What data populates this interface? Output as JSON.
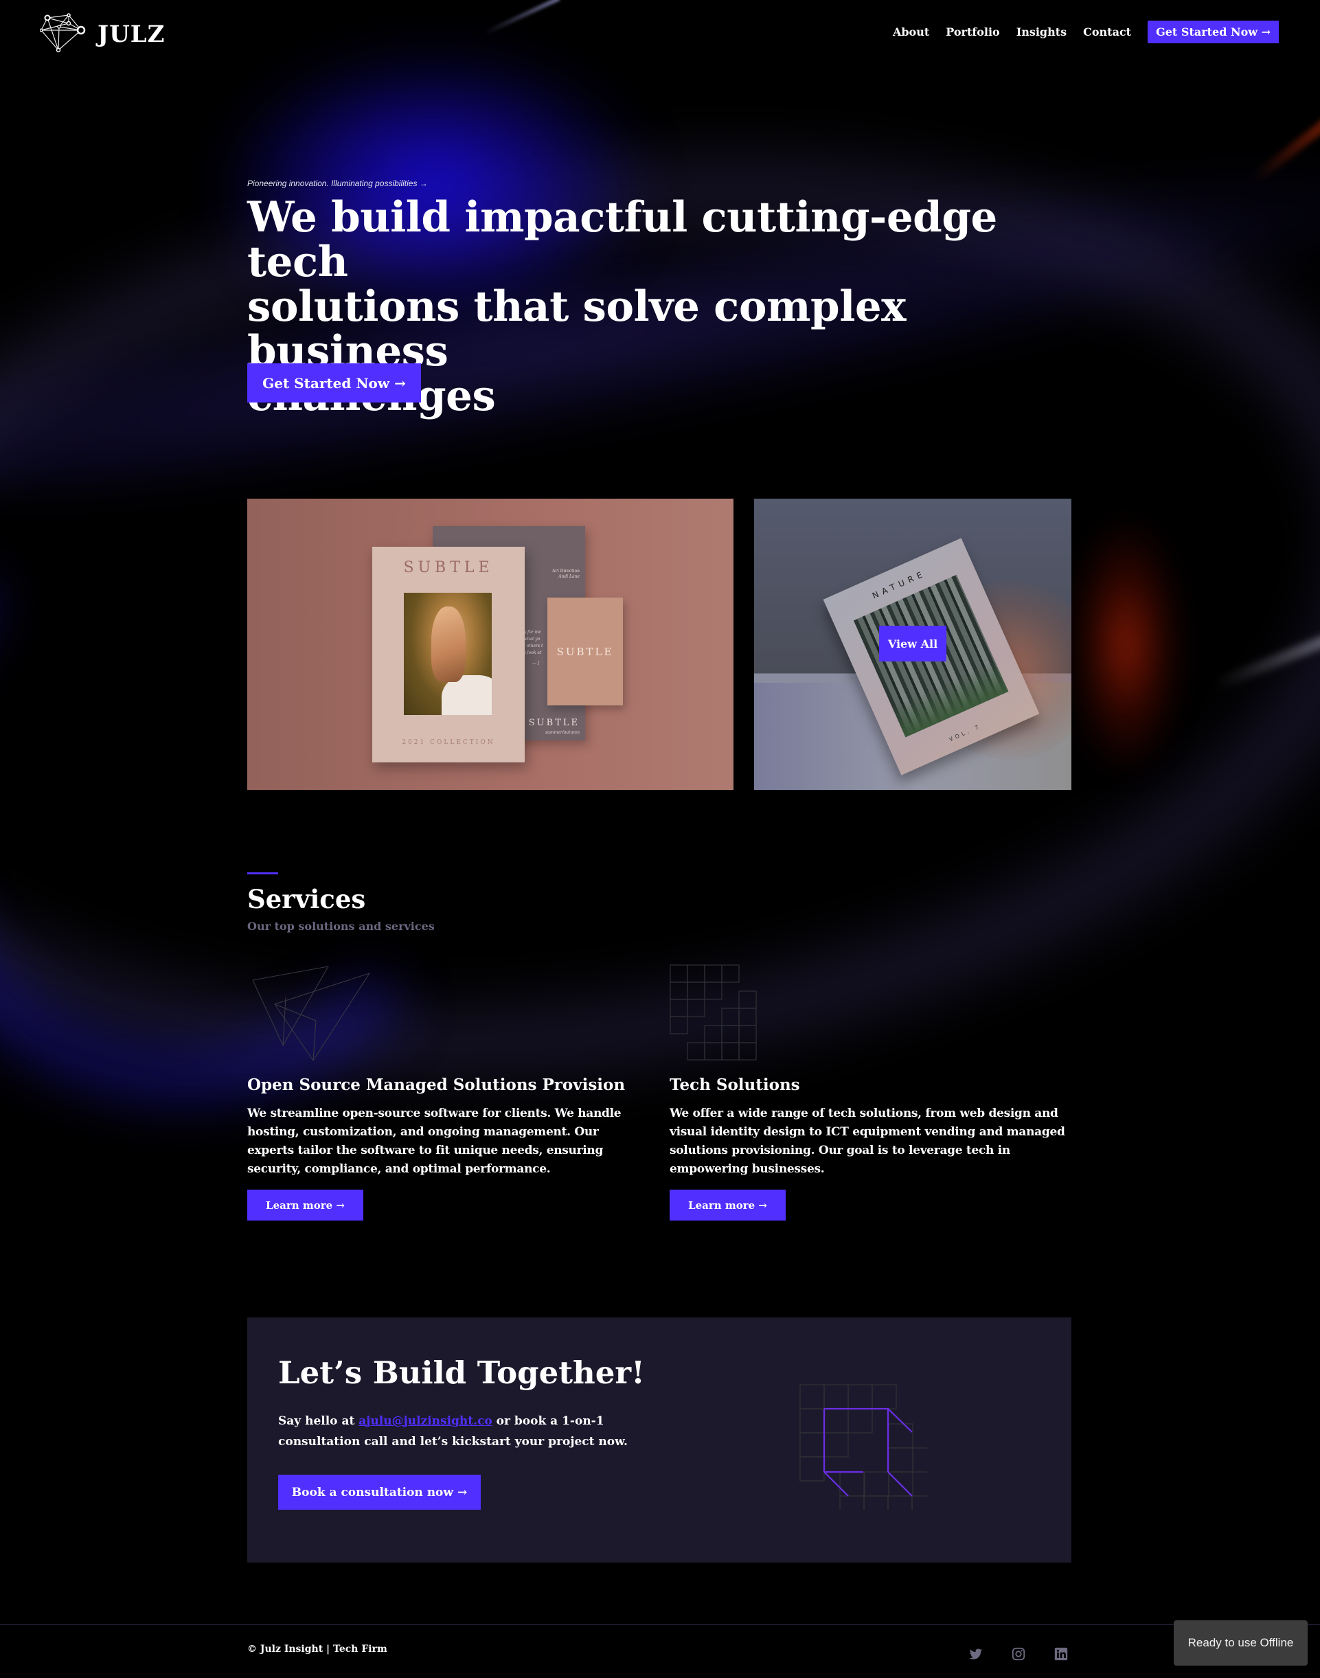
{
  "header": {
    "logo_text": "JULZ",
    "logo_icon": "network-diamond-icon",
    "nav": [
      {
        "label": "About"
      },
      {
        "label": "Portfolio"
      },
      {
        "label": "Insights"
      },
      {
        "label": "Contact"
      }
    ],
    "cta_label": "Get Started Now →"
  },
  "hero": {
    "tagline": "Pioneering innovation. Illuminating possibilities →",
    "title_lines": [
      "We build impactful cutting-edge tech",
      "solutions that solve complex business",
      "challenges"
    ],
    "cta_label": "Get Started Now →"
  },
  "portfolio": {
    "item1": {
      "main_card_title": "SUBTLE",
      "main_card_footer": "2021 COLLECTION",
      "credit_role": "Art Direction",
      "credit_name": "Andi Lane",
      "quote_lines": [
        "phy for me",
        "el what yo",
        "get others t",
        "hey look at",
        "— I"
      ],
      "back_card_title": "SUBTLE",
      "back_card_subtitle": "summer/autumn",
      "small_card_title": "SUBTLE"
    },
    "item2": {
      "book_title": "NATURE",
      "book_volume": "VOL. 7",
      "view_all_label": "View All"
    }
  },
  "services": {
    "title": "Services",
    "subtitle": "Our top solutions and services",
    "items": [
      {
        "icon": "wireframe-pyramid-icon",
        "title": "Open Source Managed Solutions Provision",
        "description": "We streamline open-source software for clients. We handle hosting, customization, and ongoing management. Our experts tailor the software to fit unique needs, ensuring security, compliance, and optimal performance.",
        "button_label": "Learn more →"
      },
      {
        "icon": "grid-blocks-icon",
        "title": "Tech Solutions",
        "description": "We offer a wide range of tech solutions, from web design and visual identity design to ICT equipment vending and managed solutions provisioning. Our goal is to leverage tech in empowering businesses.",
        "button_label": "Learn more →"
      }
    ]
  },
  "cta": {
    "title": "Let’s Build Together!",
    "text_before": "Say hello at ",
    "email": "ajulu@julzinsight.co",
    "text_after": " or book a 1-on-1 consultation call and let’s kickstart your project now.",
    "button_label": "Book a consultation now →",
    "graphic": "grid-cube-icon"
  },
  "footer": {
    "copyright": "© Julz Insight | Tech Firm",
    "socials": [
      {
        "name": "twitter-icon"
      },
      {
        "name": "instagram-icon"
      },
      {
        "name": "linkedin-icon"
      }
    ]
  },
  "toast": {
    "message": "Ready to use Offline"
  },
  "colors": {
    "accent": "#512ffe",
    "background": "#000000",
    "cta_panel": "#1c192c",
    "muted_text": "#6b6780",
    "toast_bg": "#3c3c3c"
  }
}
